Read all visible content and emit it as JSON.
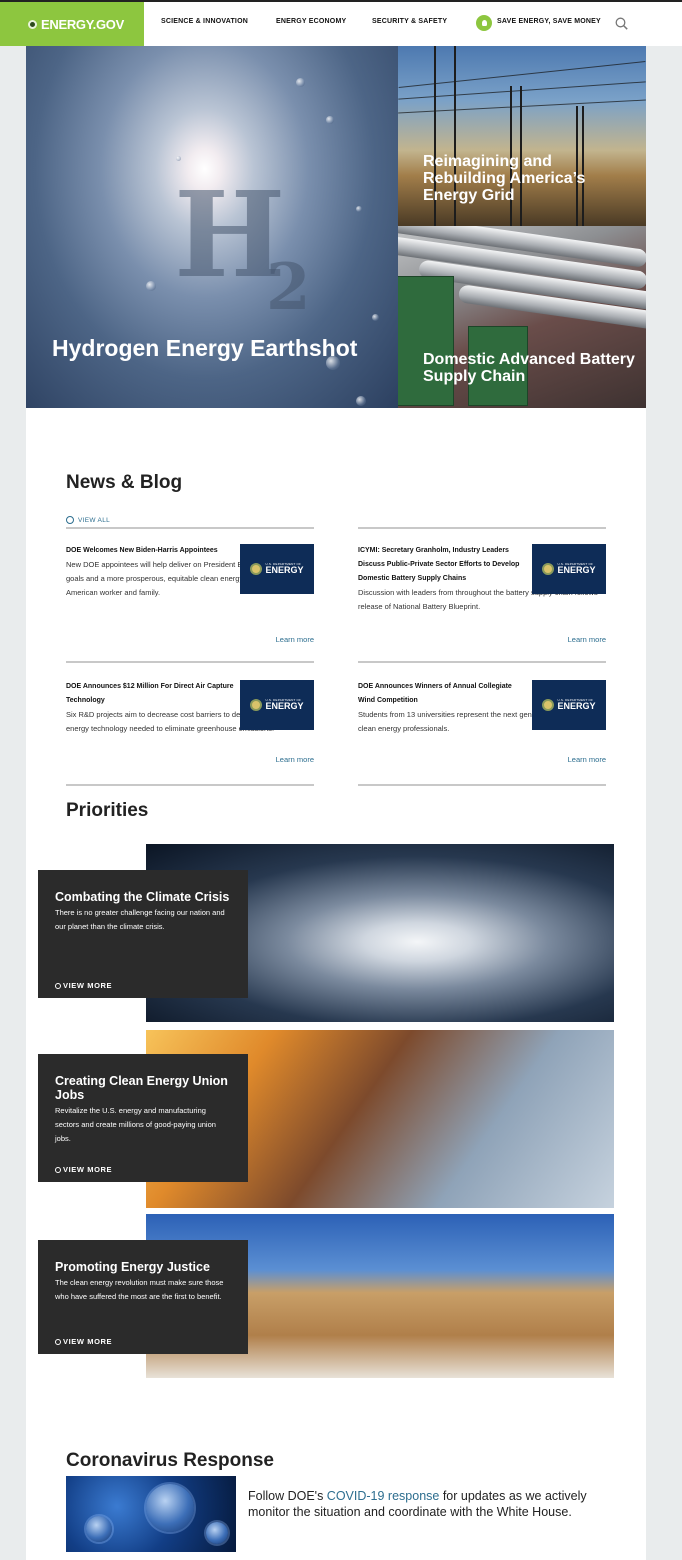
{
  "header": {
    "logo_text": "ENERGY.GOV",
    "nav": [
      {
        "label": "SCIENCE & INNOVATION"
      },
      {
        "label": "ENERGY ECONOMY"
      },
      {
        "label": "SECURITY & SAFETY"
      },
      {
        "label": "SAVE ENERGY, SAVE MONEY"
      }
    ]
  },
  "hero": {
    "main_title": "Hydrogen Energy Earthshot",
    "main_image_text_big": "H",
    "main_image_text_sub": "2",
    "grid_title": "Reimagining and Rebuilding America’s Energy Grid",
    "battery_title": "Domestic Advanced Battery Supply Chain"
  },
  "news": {
    "section_title": "News & Blog",
    "view_all": "VIEW ALL",
    "thumb_small": "U.S. DEPARTMENT OF",
    "thumb_big": "ENERGY",
    "items": [
      {
        "title": "DOE Welcomes New Biden-Harris Appointees",
        "desc": "New DOE appointees will help deliver on President Biden's bold climate goals and a more prosperous, equitable clean energy future for every American worker and family.",
        "link": "Learn more"
      },
      {
        "title": "ICYMI: Secretary Granholm, Industry Leaders Discuss Public-Private Sector Efforts to Develop Domestic Battery Supply Chains",
        "desc": "Discussion with leaders from throughout the battery supply chain follows release of National Battery Blueprint.",
        "link": "Learn more"
      },
      {
        "title": "DOE Announces $12 Million For Direct Air Capture Technology",
        "desc": "Six R&D projects aim to decrease cost barriers to deploying the clean energy technology needed to eliminate greenhouse emissions.",
        "link": "Learn more"
      },
      {
        "title": "DOE Announces Winners of Annual Collegiate Wind Competition",
        "desc": "Students from 13 universities represent the next generation of wind and clean energy professionals.",
        "link": "Learn more"
      }
    ]
  },
  "priorities": {
    "section_title": "Priorities",
    "items": [
      {
        "title": "Combating the Climate Crisis",
        "desc": "There is no greater challenge facing our nation and our planet than the climate crisis.",
        "more": "VIEW MORE"
      },
      {
        "title": "Creating Clean Energy Union Jobs",
        "desc": "Revitalize the U.S. energy and manufacturing sectors and create millions of good-paying union jobs.",
        "more": "VIEW MORE"
      },
      {
        "title": "Promoting Energy Justice",
        "desc": "The clean energy revolution must make sure those who have suffered the most are the first to benefit.",
        "more": "VIEW MORE"
      }
    ]
  },
  "covid": {
    "section_title": "Coronavirus Response",
    "text_before": "Follow DOE's ",
    "link": "COVID-19 response",
    "text_after": " for updates as we actively monitor the situation and coordinate with the White House."
  }
}
